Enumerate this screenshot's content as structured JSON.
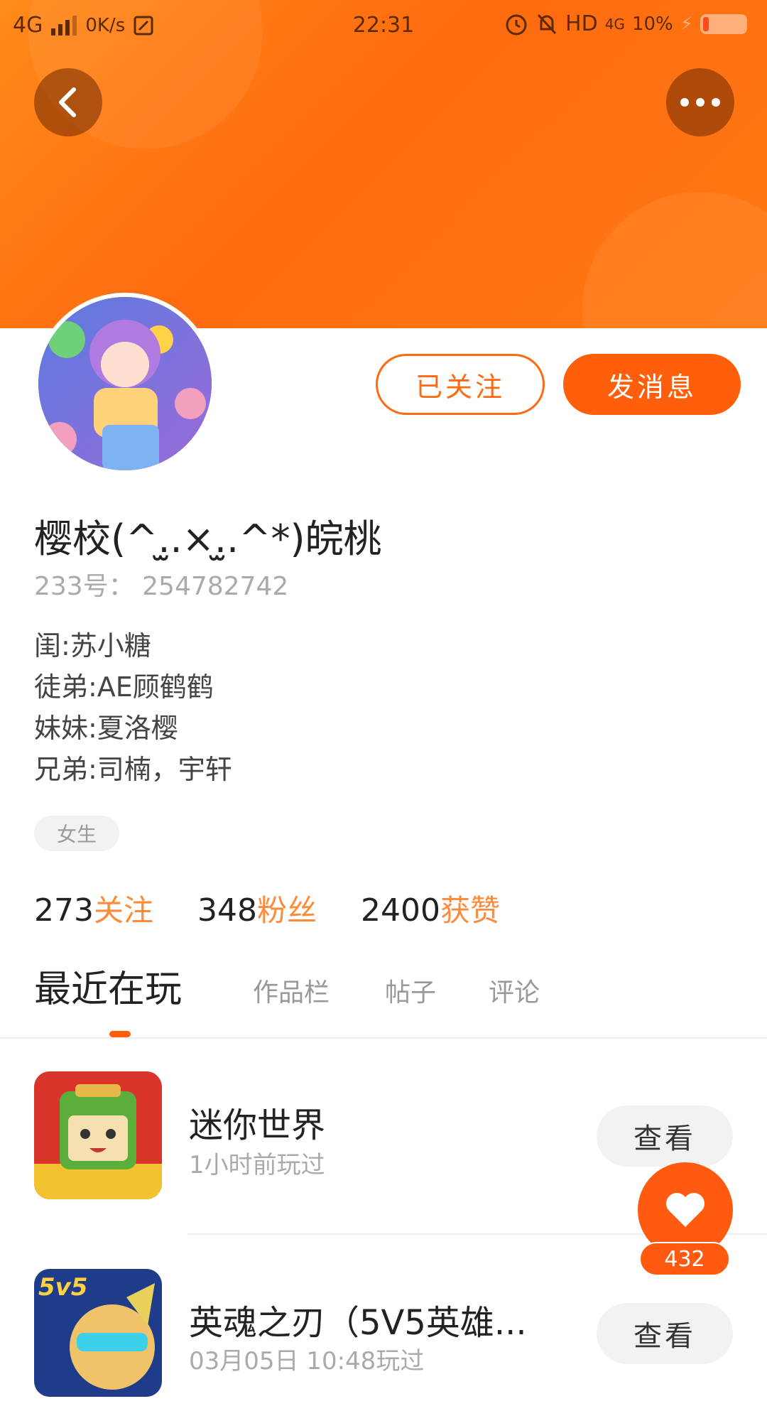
{
  "status_bar": {
    "network": "4G",
    "speed": "0K/s",
    "time": "22:31",
    "hd": "HD",
    "net2": "4G",
    "battery": "10%"
  },
  "header": {
    "back_icon": "chevron-left-icon",
    "more_icon": "more-dots-icon"
  },
  "profile": {
    "nickname": "樱校(^.̫.×.̫.^*)皖桃",
    "uid": "233号： 254782742",
    "bio": [
      "闺:苏小糖",
      "徒弟:AE顾鹤鹤",
      "妹妹:夏洛樱",
      "兄弟:司楠，宇轩"
    ],
    "gender_tag": "女生",
    "followed_label": "已关注",
    "message_label": "发消息"
  },
  "stats": [
    {
      "count": "273",
      "label": "关注"
    },
    {
      "count": "348",
      "label": "粉丝"
    },
    {
      "count": "2400",
      "label": "获赞"
    }
  ],
  "tabs": [
    "最近在玩",
    "作品栏",
    "帖子",
    "评论"
  ],
  "games": [
    {
      "name": "迷你世界",
      "time": "1小时前玩过",
      "action": "查看"
    },
    {
      "name": "英魂之刃（5V5英雄...",
      "time": "03月05日 10:48玩过",
      "action": "查看"
    }
  ],
  "game2_icon_text": "5v5",
  "like_fab": {
    "icon": "heart-icon",
    "count": "432"
  },
  "colors": {
    "accent": "#ff5f0a",
    "header": "#ff7a14"
  }
}
